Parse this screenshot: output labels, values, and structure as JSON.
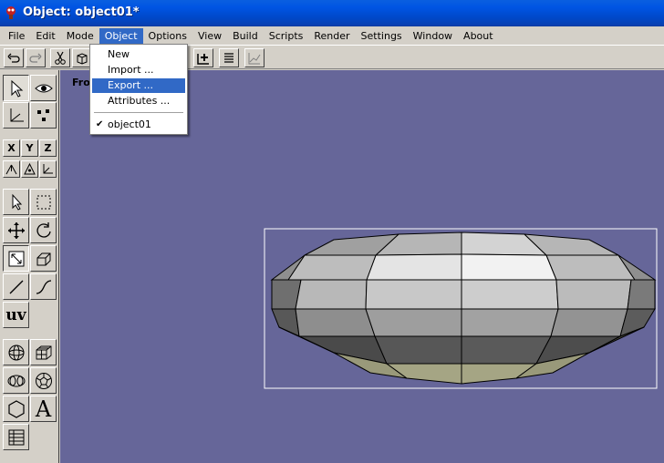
{
  "window": {
    "title": "Object: object01*"
  },
  "menubar": {
    "items": [
      {
        "label": "File"
      },
      {
        "label": "Edit"
      },
      {
        "label": "Mode"
      },
      {
        "label": "Object"
      },
      {
        "label": "Options"
      },
      {
        "label": "View"
      },
      {
        "label": "Build"
      },
      {
        "label": "Scripts"
      },
      {
        "label": "Render"
      },
      {
        "label": "Settings"
      },
      {
        "label": "Window"
      },
      {
        "label": "About"
      }
    ],
    "active": "Object"
  },
  "object_menu": {
    "items": [
      {
        "label": "New"
      },
      {
        "label": "Import ..."
      },
      {
        "label": "Export ..."
      },
      {
        "label": "Attributes ..."
      }
    ],
    "highlighted": "Export ...",
    "objects": [
      {
        "label": "object01",
        "checked": true
      }
    ]
  },
  "palette": {
    "axis_x": "X",
    "axis_y": "Y",
    "axis_z": "Z",
    "uv_label": "uv",
    "text_tool_label": "A"
  },
  "viewport": {
    "label": "Fro",
    "background": "#666699",
    "selection_color": "#ffffff"
  },
  "colors": {
    "menu_highlight": "#3169c6",
    "titlebar": "#0054e3",
    "chrome": "#d4d0c8"
  }
}
